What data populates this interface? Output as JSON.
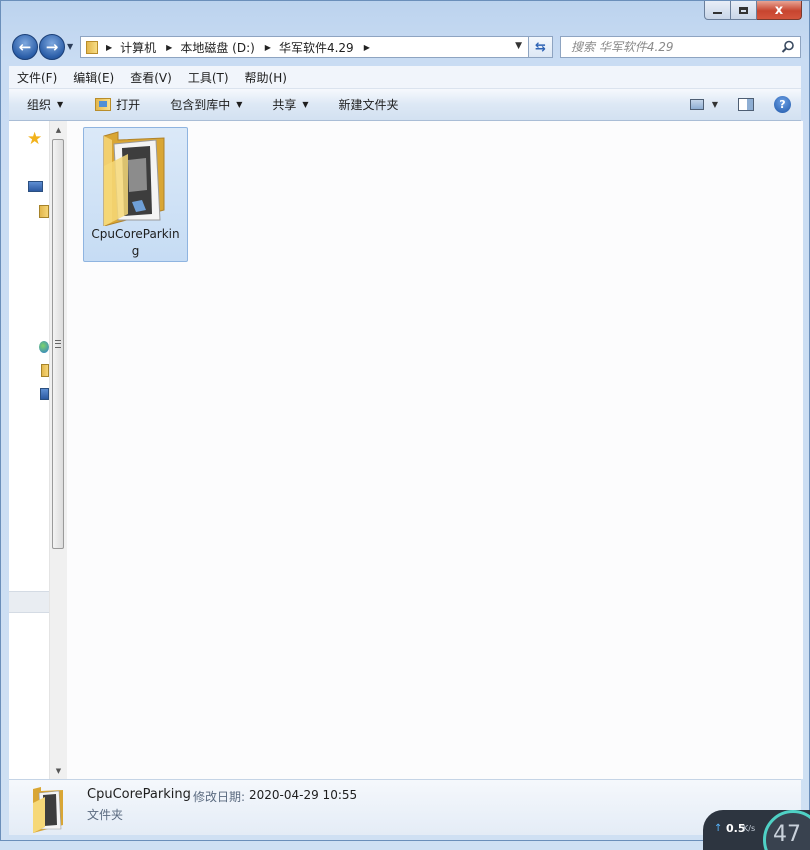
{
  "window": {
    "caption": {
      "minimize": "",
      "maximize": "",
      "close": "x"
    }
  },
  "address": {
    "crumbs": [
      "计算机",
      "本地磁盘 (D:)",
      "华军软件4.29"
    ]
  },
  "search": {
    "placeholder": "搜索 华军软件4.29"
  },
  "menu": {
    "items": [
      "文件(F)",
      "编辑(E)",
      "查看(V)",
      "工具(T)",
      "帮助(H)"
    ]
  },
  "commands": {
    "organize": "组织",
    "open": "打开",
    "include_library": "包含到库中",
    "share": "共享",
    "new_folder": "新建文件夹",
    "help": "?"
  },
  "files": [
    {
      "name": "CpuCoreParking"
    }
  ],
  "details": {
    "name": "CpuCoreParking",
    "modified_label": "修改日期:",
    "modified": "2020-04-29 10:55",
    "type": "文件夹"
  },
  "speed_widget": {
    "value": "0.5",
    "unit": "K/s",
    "number": "47"
  }
}
